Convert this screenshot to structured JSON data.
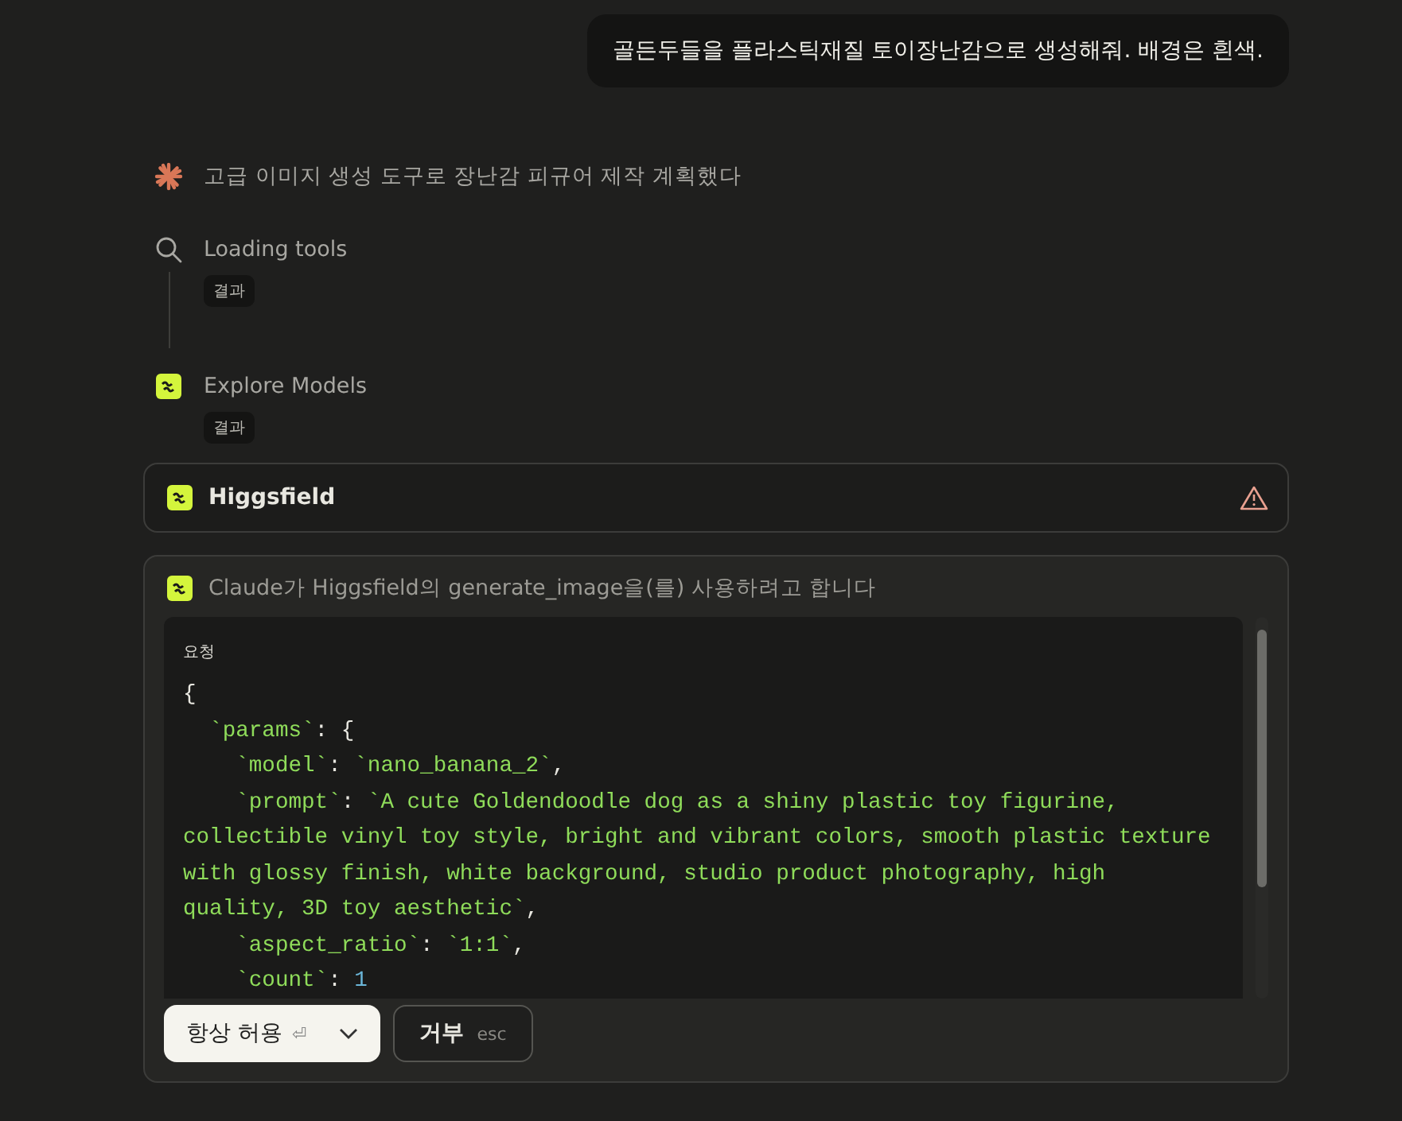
{
  "user_message": "골든두들을 플라스틱재질 토이장난감으로 생성해줘. 배경은 흰색.",
  "steps": [
    {
      "kind": "thought",
      "label": "고급 이미지 생성 도구로 장난감 피규어 제작 계획했다"
    },
    {
      "kind": "search",
      "label": "Loading tools",
      "result": "결과"
    },
    {
      "kind": "tool",
      "label": "Explore Models",
      "result": "결과"
    }
  ],
  "connector": {
    "name": "Higgsfield",
    "warning": true
  },
  "permission": {
    "title": "Claude가 Higgsfield의 generate_image을(를) 사용하려고 합니다",
    "request_label": "요청",
    "code_lines": [
      [
        {
          "kind": "punct",
          "text": "{"
        }
      ],
      [
        {
          "kind": "str",
          "text": "  `params`"
        },
        {
          "kind": "punct",
          "text": ": {"
        }
      ],
      [
        {
          "kind": "str",
          "text": "    `model`"
        },
        {
          "kind": "punct",
          "text": ": "
        },
        {
          "kind": "str",
          "text": "`nano_banana_2`"
        },
        {
          "kind": "punct",
          "text": ","
        }
      ],
      [
        {
          "kind": "str",
          "text": "    `prompt`"
        },
        {
          "kind": "punct",
          "text": ": "
        },
        {
          "kind": "str",
          "text": "`A cute Goldendoodle dog as a shiny plastic toy figurine,"
        }
      ],
      [
        {
          "kind": "str",
          "text": "collectible vinyl toy style, bright and vibrant colors, smooth plastic texture"
        }
      ],
      [
        {
          "kind": "str",
          "text": "with glossy finish, white background, studio product photography, high"
        }
      ],
      [
        {
          "kind": "str",
          "text": "quality, 3D toy aesthetic`"
        },
        {
          "kind": "punct",
          "text": ","
        }
      ],
      [
        {
          "kind": "str",
          "text": "    `aspect_ratio`"
        },
        {
          "kind": "punct",
          "text": ": "
        },
        {
          "kind": "str",
          "text": "`1:1`"
        },
        {
          "kind": "punct",
          "text": ","
        }
      ],
      [
        {
          "kind": "str",
          "text": "    `count`"
        },
        {
          "kind": "punct",
          "text": ": "
        },
        {
          "kind": "num",
          "text": "1"
        }
      ]
    ],
    "allow_button": {
      "label": "항상 허용",
      "key": "⏎"
    },
    "deny_button": {
      "label": "거부",
      "key": "esc"
    }
  }
}
